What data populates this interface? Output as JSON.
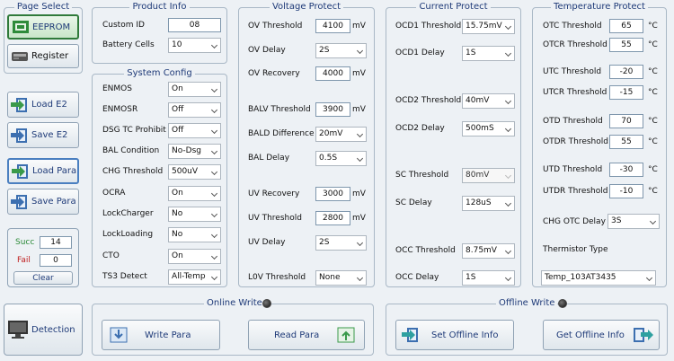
{
  "page_select": {
    "title": "Page Select",
    "eeprom": "EEPROM",
    "register": "Register"
  },
  "e2": {
    "load": "Load E2",
    "save": "Save E2",
    "load_para": "Load Para",
    "save_para": "Save Para"
  },
  "stats": {
    "succ_label": "Succ",
    "succ_value": "14",
    "fail_label": "Fail",
    "fail_value": "0",
    "clear": "Clear"
  },
  "detection": "Detection",
  "product_info": {
    "title": "Product Info",
    "custom_id_label": "Custom ID",
    "custom_id_value": "08",
    "battery_cells_label": "Battery Cells",
    "battery_cells_value": "10"
  },
  "system_config": {
    "title": "System Config",
    "rows": [
      {
        "label": "ENMOS",
        "value": "On"
      },
      {
        "label": "ENMOSR",
        "value": "Off"
      },
      {
        "label": "DSG TC Prohibit",
        "value": "Off"
      },
      {
        "label": "BAL Condition",
        "value": "No-Dsg"
      },
      {
        "label": "CHG Threshold",
        "value": "500uV"
      },
      {
        "label": "OCRA",
        "value": "On"
      },
      {
        "label": "LockCharger",
        "value": "No"
      },
      {
        "label": "LockLoading",
        "value": "No"
      },
      {
        "label": "CTO",
        "value": "On"
      },
      {
        "label": "TS3 Detect",
        "value": "All-Temp"
      }
    ]
  },
  "voltage_protect": {
    "title": "Voltage Protect",
    "ov_threshold_label": "OV Threshold",
    "ov_threshold_value": "4100",
    "ov_threshold_unit": "mV",
    "ov_delay_label": "OV Delay",
    "ov_delay_value": "2S",
    "ov_recovery_label": "OV Recovery",
    "ov_recovery_value": "4000",
    "ov_recovery_unit": "mV",
    "balv_threshold_label": "BALV Threshold",
    "balv_threshold_value": "3900",
    "balv_threshold_unit": "mV",
    "bald_difference_label": "BALD Difference",
    "bald_difference_value": "20mV",
    "bal_delay_label": "BAL Delay",
    "bal_delay_value": "0.5S",
    "uv_recovery_label": "UV Recovery",
    "uv_recovery_value": "3000",
    "uv_recovery_unit": "mV",
    "uv_threshold_label": "UV Threshold",
    "uv_threshold_value": "2800",
    "uv_threshold_unit": "mV",
    "uv_delay_label": "UV Delay",
    "uv_delay_value": "2S",
    "l0v_threshold_label": "L0V Threshold",
    "l0v_threshold_value": "None"
  },
  "current_protect": {
    "title": "Current Protect",
    "ocd1_threshold_label": "OCD1 Threshold",
    "ocd1_threshold_value": "15.75mV",
    "ocd1_delay_label": "OCD1 Delay",
    "ocd1_delay_value": "1S",
    "ocd2_threshold_label": "OCD2 Threshold",
    "ocd2_threshold_value": "40mV",
    "ocd2_delay_label": "OCD2 Delay",
    "ocd2_delay_value": "500mS",
    "sc_threshold_label": "SC Threshold",
    "sc_threshold_value": "80mV",
    "sc_delay_label": "SC Delay",
    "sc_delay_value": "128uS",
    "occ_threshold_label": "OCC Threshold",
    "occ_threshold_value": "8.75mV",
    "occ_delay_label": "OCC Delay",
    "occ_delay_value": "1S"
  },
  "temperature_protect": {
    "title": "Temperature Protect",
    "unit": "°C",
    "rows": [
      {
        "label": "OTC Threshold",
        "value": "65"
      },
      {
        "label": "OTCR Threshold",
        "value": "55"
      },
      {
        "label": "UTC Threshold",
        "value": "-20"
      },
      {
        "label": "UTCR Threshold",
        "value": "-15"
      },
      {
        "label": "OTD Threshold",
        "value": "70"
      },
      {
        "label": "OTDR Threshold",
        "value": "55"
      },
      {
        "label": "UTD Threshold",
        "value": "-30"
      },
      {
        "label": "UTDR Threshold",
        "value": "-10"
      }
    ],
    "chg_otc_delay_label": "CHG OTC Delay",
    "chg_otc_delay_value": "3S",
    "thermistor_type_label": "Thermistor Type",
    "thermistor_type_value": "Temp_103AT3435"
  },
  "online_write": {
    "title": "Online Write",
    "write_para": "Write Para",
    "read_para": "Read Para"
  },
  "offline_write": {
    "title": "Offline Write",
    "set_offline_info": "Set Offline Info",
    "get_offline_info": "Get Offline Info"
  }
}
